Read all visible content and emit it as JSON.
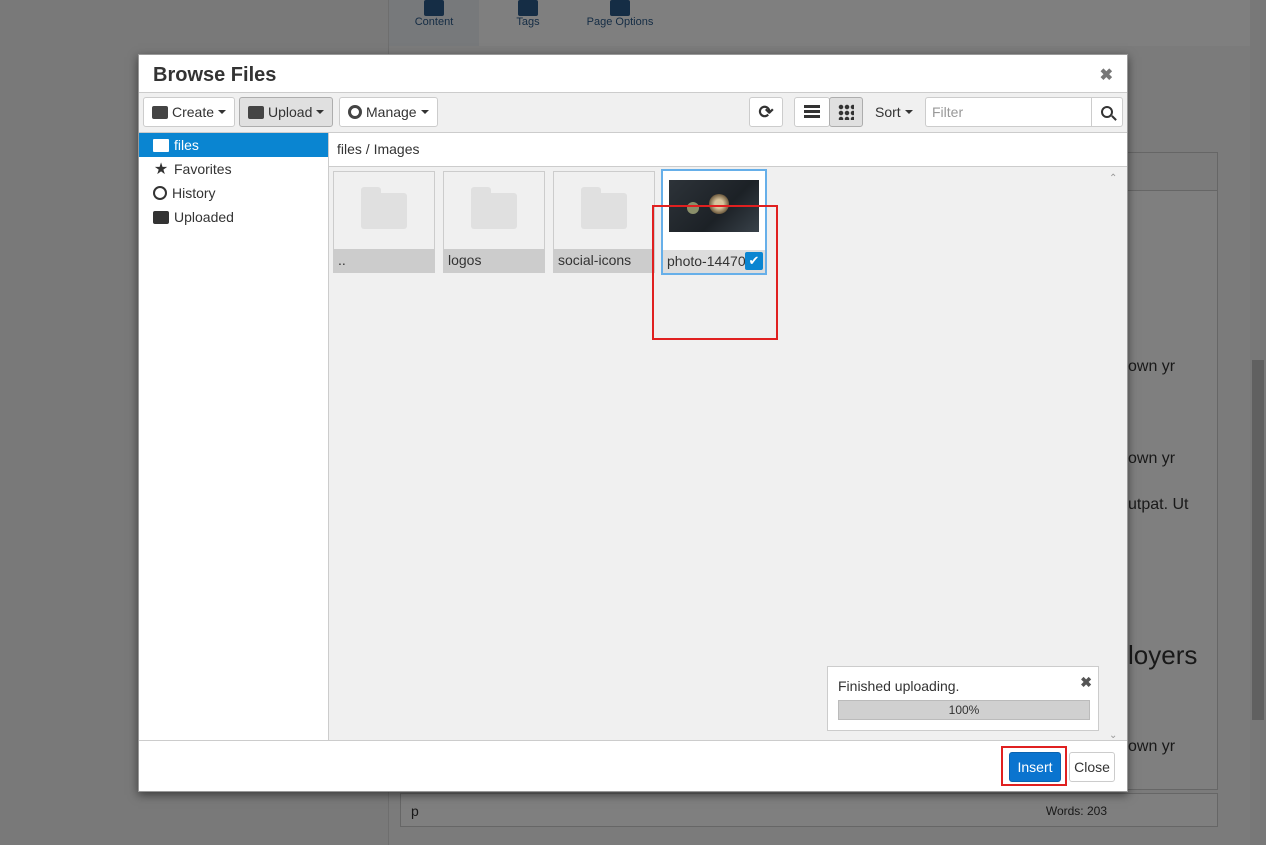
{
  "background": {
    "tabs": [
      {
        "label": "Content",
        "icon": "grid-icon"
      },
      {
        "label": "Tags",
        "icon": "tag-icon"
      },
      {
        "label": "Page Options",
        "icon": "menu-icon"
      }
    ],
    "editor_snippets": [
      "own yr",
      "own yr",
      "utpat. Ut",
      "loyers",
      "own yr"
    ],
    "statusbar": {
      "path": "p",
      "words": "Words: 203"
    }
  },
  "modal": {
    "title": "Browse Files",
    "close_symbol": "✖",
    "toolbar": {
      "create_label": "Create",
      "upload_label": "Upload",
      "manage_label": "Manage",
      "sort_label": "Sort",
      "filter_placeholder": "Filter"
    },
    "sidebar": {
      "items": [
        {
          "label": "files",
          "icon": "folder-icon",
          "active": true
        },
        {
          "label": "Favorites",
          "icon": "star-icon"
        },
        {
          "label": "History",
          "icon": "clock-icon"
        },
        {
          "label": "Uploaded",
          "icon": "upload-icon"
        }
      ]
    },
    "breadcrumb": "files / Images",
    "tiles": [
      {
        "label": "..",
        "type": "folder"
      },
      {
        "label": "logos",
        "type": "folder"
      },
      {
        "label": "social-icons",
        "type": "folder"
      },
      {
        "label": "photo-14470",
        "type": "image",
        "selected": true
      }
    ],
    "toast": {
      "message": "Finished uploading.",
      "progress_text": "100%",
      "progress": 1.0
    },
    "footer": {
      "insert_label": "Insert",
      "close_label": "Close"
    }
  },
  "colors": {
    "accent": "#0a85d1",
    "highlight": "#e02020"
  }
}
